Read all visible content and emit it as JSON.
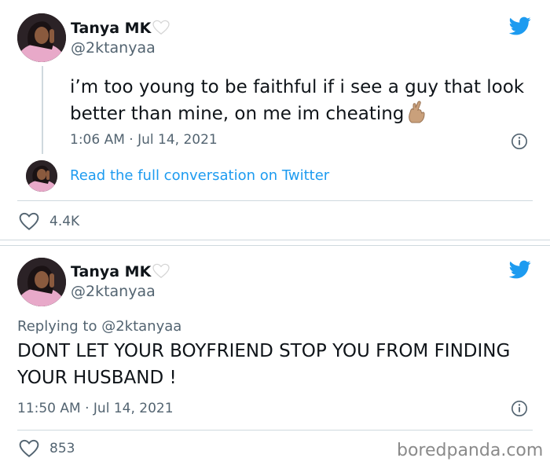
{
  "tweet1": {
    "display_name": "Tanya MK",
    "handle": "@2ktanyaa",
    "text": "i’m too young to be faithful if i see a guy that look better than mine, on me im cheating",
    "time": "1:06 AM · Jul 14, 2021",
    "read_link": "Read the full conversation on Twitter",
    "likes": "4.4K"
  },
  "tweet2": {
    "display_name": "Tanya MK",
    "handle": "@2ktanyaa",
    "replying_to": "Replying to @2ktanyaa",
    "text": "DONT LET YOUR BOYFRIEND STOP YOU FROM FINDING YOUR HUSBAND !",
    "time": "11:50 AM · Jul 14, 2021",
    "likes": "853"
  },
  "watermark": "boredpanda.com",
  "colors": {
    "twitter_blue": "#1d9bf0",
    "secondary_text": "#536471",
    "divider": "#cfd9de"
  },
  "icons": {
    "logo": "twitter-bird-icon",
    "info": "info-icon",
    "like": "heart-outline-icon",
    "name_emoji": "white-heart-emoji",
    "text_emoji": "crossed-fingers-emoji"
  }
}
